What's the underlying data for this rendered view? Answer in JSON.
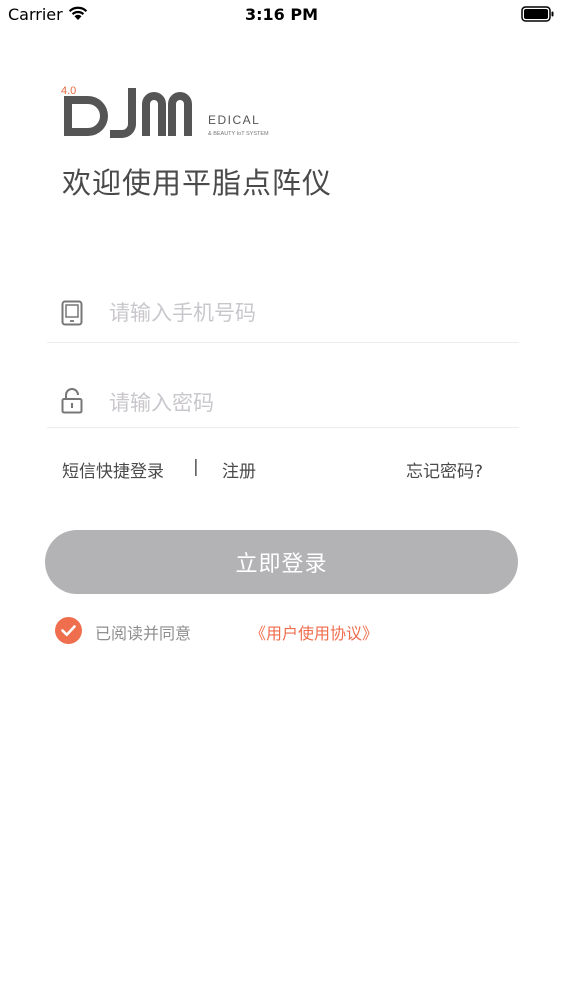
{
  "status_bar": {
    "carrier": "Carrier",
    "time": "3:16 PM"
  },
  "logo": {
    "version": "4.0",
    "wordmark": "DIM",
    "suffix": "EDICAL",
    "tagline": "& BEAUTY IoT SYSTEM"
  },
  "welcome": "欢迎使用平脂点阵仪",
  "phone": {
    "placeholder": "请输入手机号码",
    "value": ""
  },
  "password": {
    "placeholder": "请输入密码",
    "value": ""
  },
  "links": {
    "sms_login": "短信快捷登录",
    "divider": "|",
    "register": "注册",
    "forgot": "忘记密码?"
  },
  "login_button": "立即登录",
  "agreement": {
    "checked": true,
    "text": "已阅读并同意",
    "link": "《用户使用协议》"
  },
  "colors": {
    "accent": "#ef6e4e",
    "button_disabled": "#b3b2b5",
    "text": "#4a4a4a",
    "placeholder": "#c9c7cc"
  }
}
